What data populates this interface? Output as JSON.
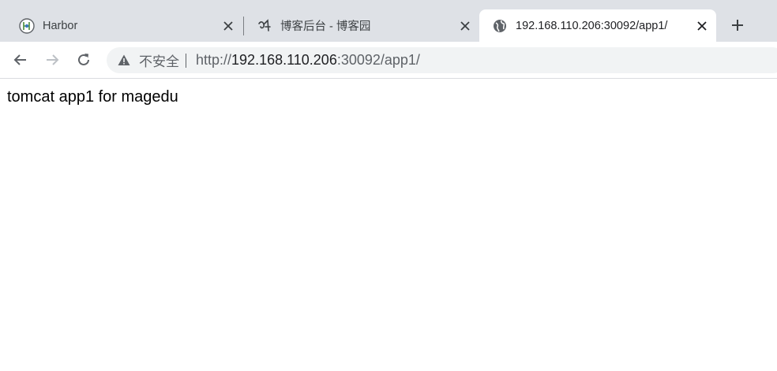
{
  "tabs": [
    {
      "title": "Harbor",
      "favicon": "harbor-logo-icon",
      "active": false
    },
    {
      "title": "博客后台 - 博客园",
      "favicon": "cnblogs-logo-icon",
      "active": false
    },
    {
      "title": "192.168.110.206:30092/app1/",
      "favicon": "globe-icon",
      "active": true
    }
  ],
  "toolbar": {
    "security_label": "不安全",
    "url_scheme": "http://",
    "url_host": "192.168.110.206",
    "url_rest": ":30092/app1/"
  },
  "page": {
    "body_text": "tomcat app1 for magedu"
  },
  "colors": {
    "tabstrip_bg": "#dee1e6",
    "active_tab_bg": "#ffffff",
    "omnibox_bg": "#f1f3f4",
    "icon_gray": "#5f6368"
  }
}
